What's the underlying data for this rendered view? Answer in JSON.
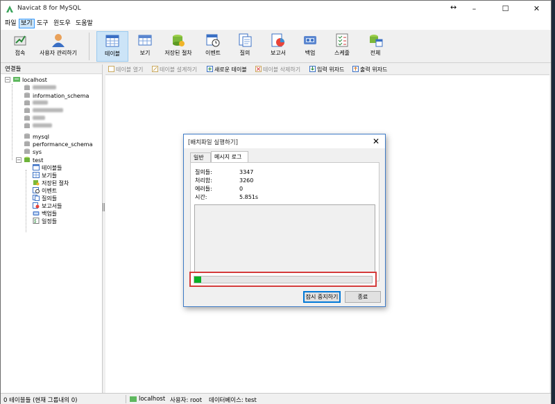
{
  "window": {
    "title": "Navicat 8 for MySQL",
    "resize_glyph": "↔",
    "min": "–",
    "max": "☐",
    "close": "✕"
  },
  "menu": [
    "파일",
    "보기",
    "도구",
    "윈도우",
    "도움말"
  ],
  "toolbar": [
    {
      "label": "접속",
      "icon": "connect-icon"
    },
    {
      "label": "사용자 관리하기",
      "icon": "user-manager-icon"
    },
    {
      "label": "테이블",
      "icon": "table-icon"
    },
    {
      "label": "보기",
      "icon": "view-icon"
    },
    {
      "label": "저장된 절차",
      "icon": "procedure-icon"
    },
    {
      "label": "이벤트",
      "icon": "event-icon"
    },
    {
      "label": "질의",
      "icon": "query-icon"
    },
    {
      "label": "보고서",
      "icon": "report-icon"
    },
    {
      "label": "백업",
      "icon": "backup-icon"
    },
    {
      "label": "스케줄",
      "icon": "schedule-icon"
    },
    {
      "label": "전체",
      "icon": "all-icon"
    }
  ],
  "connections": {
    "header": "연결들",
    "root": "localhost",
    "databases": [
      "information_schema",
      "mysql",
      "performance_schema",
      "sys",
      "test"
    ],
    "test_children": [
      "테이블들",
      "보기들",
      "저장된 절차",
      "이벤트",
      "질의들",
      "보고서들",
      "백업들",
      "일정들"
    ]
  },
  "object_toolbar": [
    "테이블 열기",
    "테이블 설계하기",
    "새로운 테이블",
    "테이블 삭제하기",
    "입력 위자드",
    "출력 위자드"
  ],
  "status": {
    "left": "0 테이블들 (현재 그룹내의 0)",
    "server": "localhost",
    "user": "사용자: root",
    "database": "데이터베이스: test"
  },
  "dialog": {
    "title": "[배치파일 실행하기]",
    "close": "✕",
    "tabs": [
      "일반",
      "메시지 로그"
    ],
    "stats": [
      {
        "label": "질의들:",
        "value": "3347"
      },
      {
        "label": "처리함:",
        "value": "3260"
      },
      {
        "label": "에러들:",
        "value": "0"
      },
      {
        "label": "시간:",
        "value": "5.851s"
      }
    ],
    "progress": 0.04,
    "pause_button": "잠시 중지하기",
    "close_button": "종료"
  }
}
